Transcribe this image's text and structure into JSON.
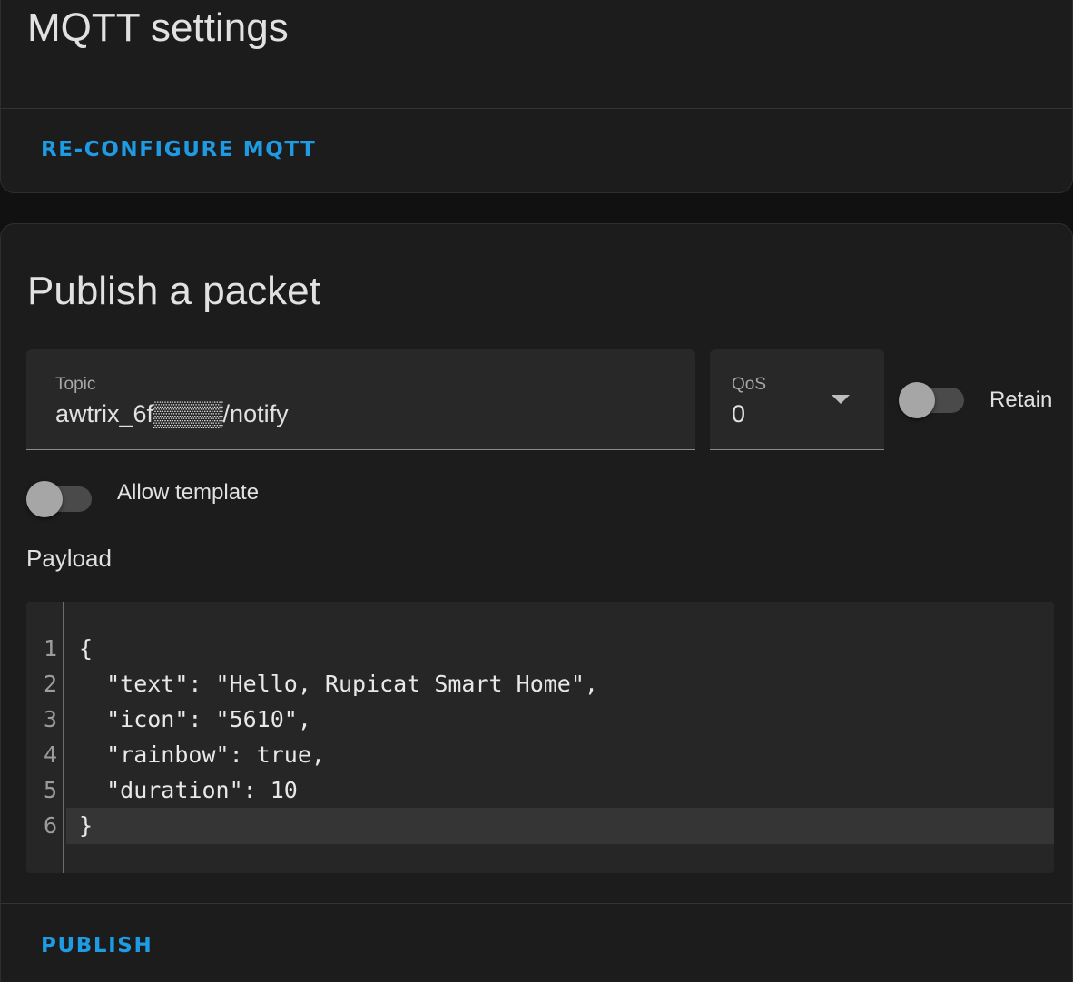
{
  "settings_card": {
    "title": "MQTT settings",
    "reconfigure_label": "RE-CONFIGURE MQTT"
  },
  "publish_card": {
    "title": "Publish a packet",
    "topic": {
      "label": "Topic",
      "value": "awtrix_6f▒▒▒▒/notify"
    },
    "qos": {
      "label": "QoS",
      "value": "0"
    },
    "retain": {
      "label": "Retain",
      "checked": false
    },
    "allow_template": {
      "label": "Allow template",
      "checked": false
    },
    "payload_label": "Payload",
    "payload_lines": [
      {
        "num": "1",
        "text": "{"
      },
      {
        "num": "2",
        "text": "  \"text\": \"Hello, Rupicat Smart Home\","
      },
      {
        "num": "3",
        "text": "  \"icon\": \"5610\","
      },
      {
        "num": "4",
        "text": "  \"rainbow\": true,"
      },
      {
        "num": "5",
        "text": "  \"duration\": 10"
      },
      {
        "num": "6",
        "text": "}"
      }
    ],
    "publish_label": "PUBLISH"
  },
  "colors": {
    "accent": "#1e9be3",
    "card_background": "#1c1c1c",
    "page_background": "#111111"
  }
}
